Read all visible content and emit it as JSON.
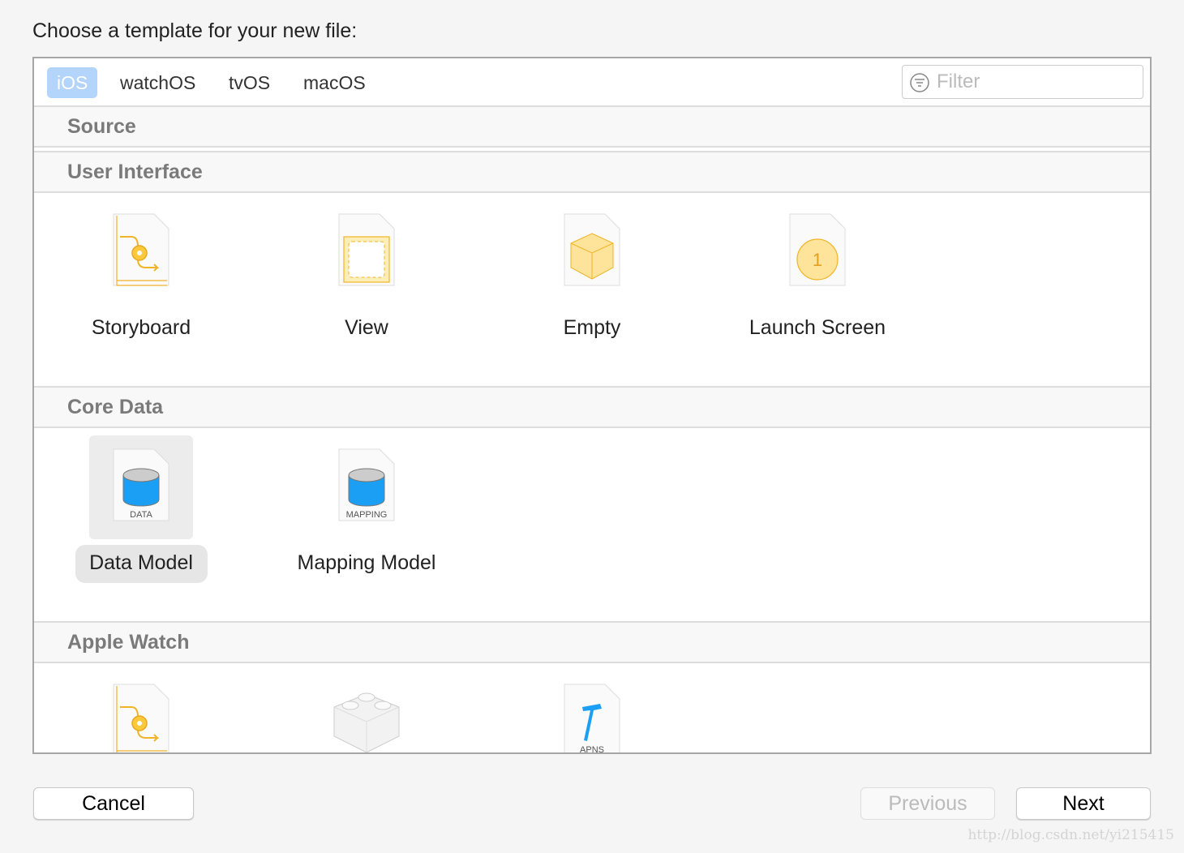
{
  "prompt": "Choose a template for your new file:",
  "tabs": [
    {
      "label": "iOS",
      "selected": true
    },
    {
      "label": "watchOS"
    },
    {
      "label": "tvOS"
    },
    {
      "label": "macOS"
    }
  ],
  "filter": {
    "placeholder": "Filter",
    "value": "",
    "icon": "filter-icon"
  },
  "sections": [
    {
      "title": "Source",
      "items": []
    },
    {
      "title": "User Interface",
      "items": [
        {
          "label": "Storyboard",
          "icon": "storyboard-icon"
        },
        {
          "label": "View",
          "icon": "view-icon"
        },
        {
          "label": "Empty",
          "icon": "empty-cube-icon"
        },
        {
          "label": "Launch Screen",
          "icon": "launch-screen-icon",
          "badge": "1"
        }
      ]
    },
    {
      "title": "Core Data",
      "items": [
        {
          "label": "Data Model",
          "icon": "data-model-icon",
          "caption": "DATA",
          "selected": true
        },
        {
          "label": "Mapping Model",
          "icon": "mapping-model-icon",
          "caption": "MAPPING"
        }
      ]
    },
    {
      "title": "Apple Watch",
      "items": [
        {
          "icon": "watch-storyboard-icon"
        },
        {
          "icon": "lego-block-icon"
        },
        {
          "icon": "apns-icon",
          "caption": "APNS"
        }
      ]
    }
  ],
  "buttons": {
    "cancel": "Cancel",
    "previous": "Previous",
    "next": "Next"
  },
  "watermark": "http://blog.csdn.net/yi215415",
  "colors": {
    "accent": "#b3d4fb",
    "icon_yellow": "#f0b429",
    "db_blue": "#1a9ff5"
  }
}
